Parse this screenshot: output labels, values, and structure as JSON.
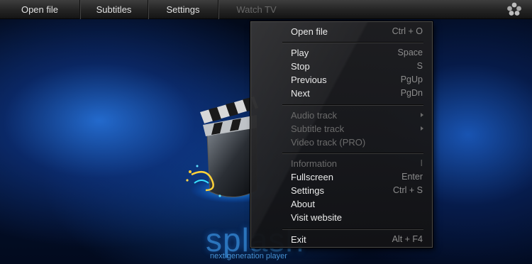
{
  "menubar": {
    "items": [
      {
        "label": "Open file",
        "enabled": true
      },
      {
        "label": "Subtitles",
        "enabled": true
      },
      {
        "label": "Settings",
        "enabled": true
      },
      {
        "label": "Watch TV",
        "enabled": false
      }
    ],
    "settings_icon": "gear-icon"
  },
  "branding": {
    "logo_icon": "clapperboard-icon",
    "name": "splash",
    "tagline": "next generation player"
  },
  "context_menu": {
    "groups": [
      [
        {
          "label": "Open file",
          "shortcut": "Ctrl + O",
          "enabled": true
        }
      ],
      [
        {
          "label": "Play",
          "shortcut": "Space",
          "enabled": true
        },
        {
          "label": "Stop",
          "shortcut": "S",
          "enabled": true
        },
        {
          "label": "Previous",
          "shortcut": "PgUp",
          "enabled": true
        },
        {
          "label": "Next",
          "shortcut": "PgDn",
          "enabled": true
        }
      ],
      [
        {
          "label": "Audio track",
          "submenu": true,
          "enabled": false
        },
        {
          "label": "Subtitle track",
          "submenu": true,
          "enabled": false
        },
        {
          "label": "Video track (PRO)",
          "enabled": false
        }
      ],
      [
        {
          "label": "Information",
          "shortcut": "I",
          "enabled": false
        },
        {
          "label": "Fullscreen",
          "shortcut": "Enter",
          "enabled": true
        },
        {
          "label": "Settings",
          "shortcut": "Ctrl + S",
          "enabled": true
        },
        {
          "label": "About",
          "enabled": true
        },
        {
          "label": "Visit website",
          "enabled": true
        }
      ],
      [
        {
          "label": "Exit",
          "shortcut": "Alt + F4",
          "enabled": true
        }
      ]
    ]
  },
  "colors": {
    "menu_text": "#ececec",
    "disabled_text": "#6b6b6b",
    "shortcut_text": "#8c8c8c",
    "accent_blue": "#1e7be6"
  }
}
